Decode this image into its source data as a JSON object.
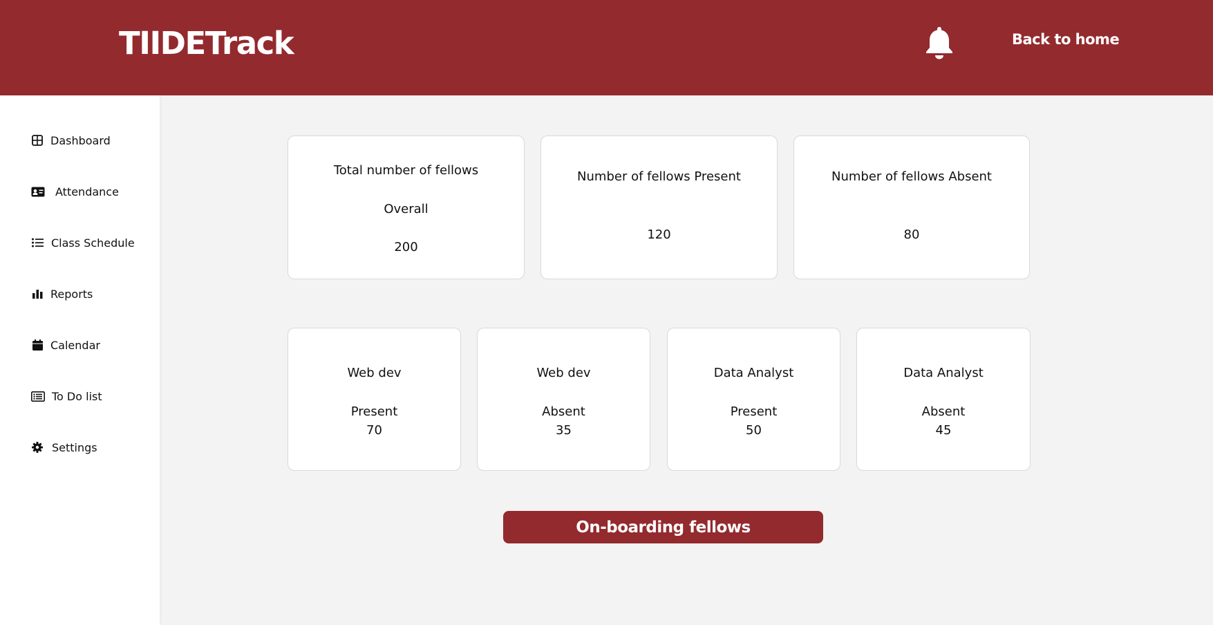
{
  "app": {
    "brand": "TIIDETrack",
    "back_home_label": "Back to home",
    "accent_color": "#932a2e"
  },
  "sidebar": {
    "items": [
      {
        "label": "Dashboard",
        "icon": "grid-icon"
      },
      {
        "label": "Attendance",
        "icon": "id-card-icon"
      },
      {
        "label": "Class Schedule",
        "icon": "list-icon"
      },
      {
        "label": "Reports",
        "icon": "bar-chart-icon"
      },
      {
        "label": "Calendar",
        "icon": "calendar-icon"
      },
      {
        "label": "To Do list",
        "icon": "todo-list-icon"
      },
      {
        "label": "Settings",
        "icon": "gear-icon"
      }
    ]
  },
  "summary_cards": [
    {
      "title": "Total number of fellows",
      "subtitle": "Overall",
      "value": "200"
    },
    {
      "title": "Number of fellows Present",
      "value": "120"
    },
    {
      "title": "Number of fellows Absent",
      "value": "80"
    }
  ],
  "track_cards": [
    {
      "title": "Web dev",
      "status": "Present",
      "value": "70"
    },
    {
      "title": "Web dev",
      "status": "Absent",
      "value": "35"
    },
    {
      "title": "Data Analyst",
      "status": "Present",
      "value": "50"
    },
    {
      "title": "Data Analyst",
      "status": "Absent",
      "value": "45"
    }
  ],
  "cta": {
    "label": "On-boarding fellows"
  }
}
